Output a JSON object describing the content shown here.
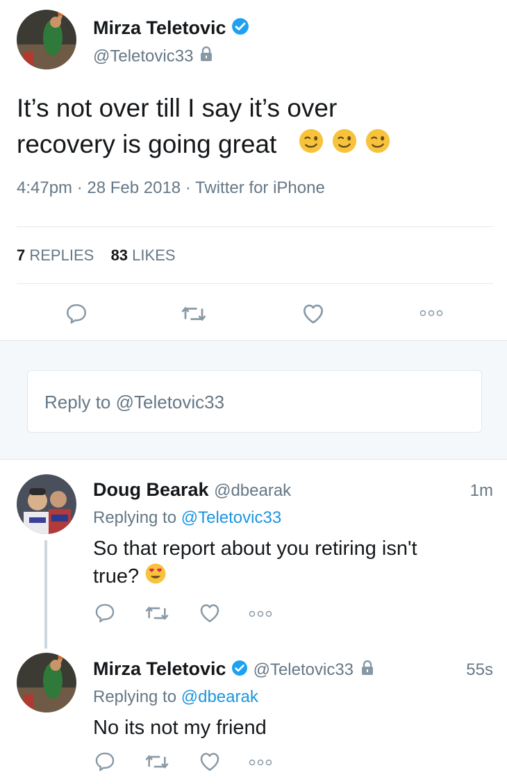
{
  "main_tweet": {
    "author_name": "Mirza Teletovic",
    "author_handle": "@Teletovic33",
    "text_line1": "It’s not over  till  I say it’s over",
    "text_line2": "recovery is going great",
    "meta": "4:47pm · 28 Feb 2018 · Twitter for iPhone",
    "replies_count": "7",
    "replies_label": "REPLIES",
    "likes_count": "83",
    "likes_label": "LIKES"
  },
  "reply_box": {
    "placeholder": "Reply to @Teletovic33"
  },
  "replies": [
    {
      "author_name": "Doug Bearak",
      "author_handle": "@dbearak",
      "time": "1m",
      "replying_prefix": "Replying to",
      "replying_to": "@Teletovic33",
      "text_line1": "So that report about you retiring isn't",
      "text_line2": "true?"
    },
    {
      "author_name": "Mirza Teletovic",
      "author_handle": "@Teletovic33",
      "time": "55s",
      "replying_prefix": "Replying to",
      "replying_to": "@dbearak",
      "text_line1": "No its not my friend"
    }
  ],
  "icons": [
    "verified-icon",
    "lock-icon",
    "reply-icon",
    "retweet-icon",
    "like-icon",
    "more-icon",
    "winking-face-emoji",
    "heart-eyes-emoji"
  ],
  "colors": {
    "accent": "#1da1f2",
    "link": "#1b95e0",
    "grey_text": "#657786",
    "divider": "#e1e8ed",
    "composer_bg": "#f5f8fa"
  }
}
